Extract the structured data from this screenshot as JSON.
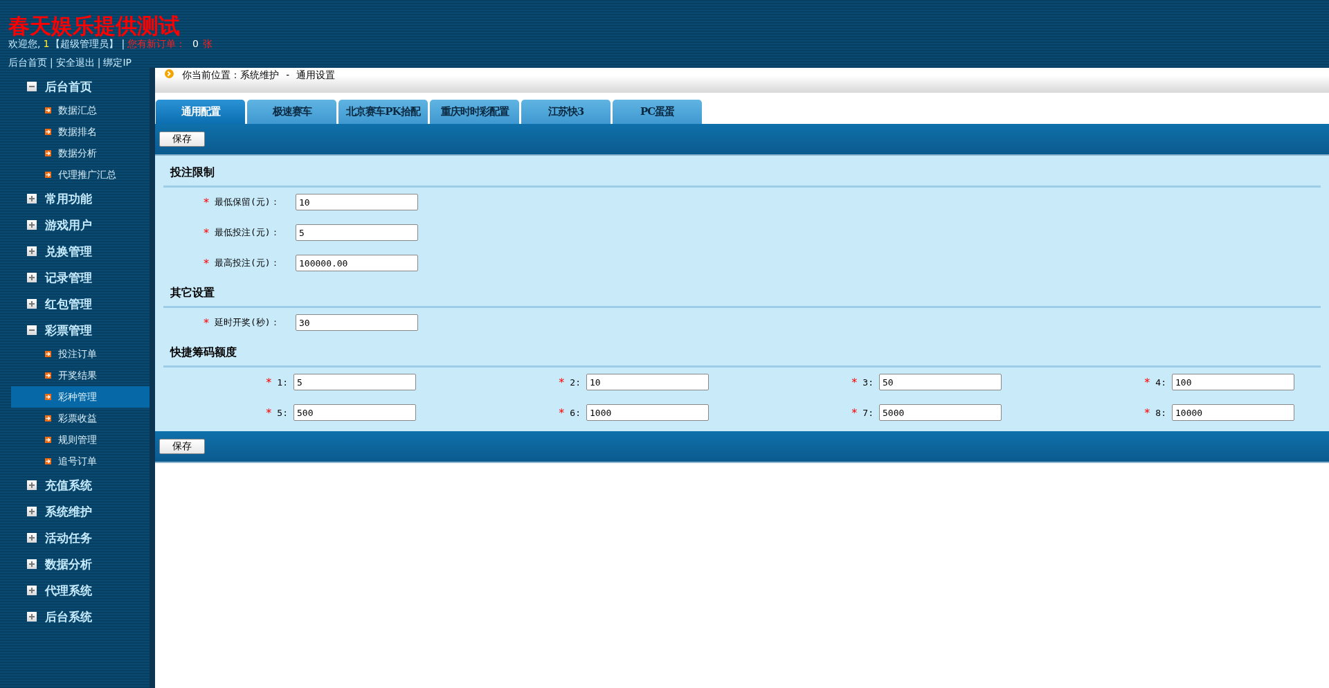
{
  "header": {
    "title": "春天娱乐提供测试",
    "welcome": "欢迎您,",
    "user_id": "1",
    "role": "【超级管理员】",
    "separator": "|",
    "orders_label": "您有新订单：",
    "orders_count": "0",
    "orders_unit": "张",
    "links": [
      "后台首页",
      "安全退出",
      "绑定IP"
    ],
    "link_separator": "|"
  },
  "sidebar": {
    "groups": [
      {
        "label": "后台首页",
        "expanded": true,
        "children": [
          {
            "label": "数据汇总",
            "selected": false
          },
          {
            "label": "数据排名",
            "selected": false
          },
          {
            "label": "数据分析",
            "selected": false
          },
          {
            "label": "代理推广汇总",
            "selected": false
          }
        ]
      },
      {
        "label": "常用功能",
        "expanded": false
      },
      {
        "label": "游戏用户",
        "expanded": false
      },
      {
        "label": "兑换管理",
        "expanded": false
      },
      {
        "label": "记录管理",
        "expanded": false
      },
      {
        "label": "红包管理",
        "expanded": false
      },
      {
        "label": "彩票管理",
        "expanded": true,
        "children": [
          {
            "label": "投注订单",
            "selected": false
          },
          {
            "label": "开奖结果",
            "selected": false
          },
          {
            "label": "彩种管理",
            "selected": true
          },
          {
            "label": "彩票收益",
            "selected": false
          },
          {
            "label": "规则管理",
            "selected": false
          },
          {
            "label": "追号订单",
            "selected": false
          }
        ]
      },
      {
        "label": "充值系统",
        "expanded": false
      },
      {
        "label": "系统维护",
        "expanded": false
      },
      {
        "label": "活动任务",
        "expanded": false
      },
      {
        "label": "数据分析",
        "expanded": false
      },
      {
        "label": "代理系统",
        "expanded": false
      },
      {
        "label": "后台系统",
        "expanded": false
      }
    ]
  },
  "breadcrumb": "你当前位置：系统维护 - 通用设置",
  "tabs": [
    {
      "label": "通用配置",
      "selected": true
    },
    {
      "label": "极速赛车",
      "selected": false
    },
    {
      "label": "北京赛车PK拾配",
      "selected": false
    },
    {
      "label": "重庆时时彩配置",
      "selected": false
    },
    {
      "label": "江苏快3",
      "selected": false
    },
    {
      "label": "PC蛋蛋",
      "selected": false
    }
  ],
  "save_button_top": "保存",
  "sections": [
    {
      "title": "投注限制",
      "kind": "single",
      "fields": [
        {
          "label": "最低保留(元)：",
          "value": "10",
          "required": true
        },
        {
          "label": "最低投注(元)：",
          "value": "5",
          "required": true
        },
        {
          "label": "最高投注(元)：",
          "value": "100000.00",
          "required": true
        }
      ]
    },
    {
      "title": "其它设置",
      "kind": "single",
      "fields": [
        {
          "label": "延时开奖(秒)：",
          "value": "30",
          "required": true
        }
      ]
    },
    {
      "title": "快捷筹码额度",
      "kind": "grid",
      "fields": [
        {
          "label": "1:",
          "value": "5",
          "required": true
        },
        {
          "label": "2:",
          "value": "10",
          "required": true
        },
        {
          "label": "3:",
          "value": "50",
          "required": true
        },
        {
          "label": "4:",
          "value": "100",
          "required": true
        },
        {
          "label": "5:",
          "value": "500",
          "required": true
        },
        {
          "label": "6:",
          "value": "1000",
          "required": true
        },
        {
          "label": "7:",
          "value": "5000",
          "required": true
        },
        {
          "label": "8:",
          "value": "10000",
          "required": true
        }
      ]
    }
  ],
  "required_mark": "*",
  "save_button_bottom": "保存"
}
